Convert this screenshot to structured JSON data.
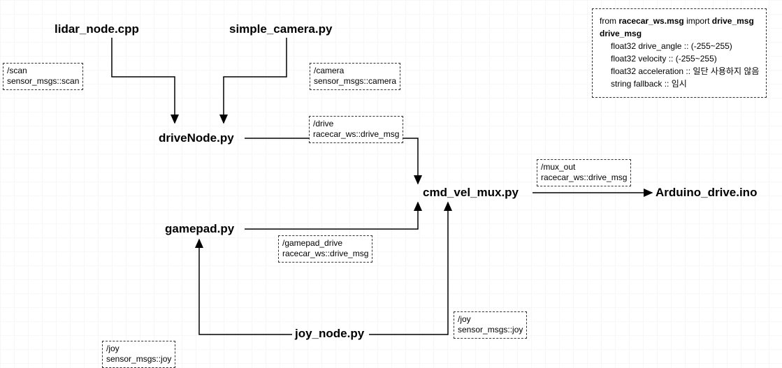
{
  "nodes": {
    "lidar": "lidar_node.cpp",
    "camera": "simple_camera.py",
    "drive": "driveNode.py",
    "gamepad": "gamepad.py",
    "mux": "cmd_vel_mux.py",
    "arduino": "Arduino_drive.ino",
    "joy": "joy_node.py"
  },
  "topics": {
    "scan": {
      "topic": "/scan",
      "type": "sensor_msgs::scan"
    },
    "camera": {
      "topic": "/camera",
      "type": "sensor_msgs::camera"
    },
    "drive": {
      "topic": "/drive",
      "type": "racecar_ws::drive_msg"
    },
    "gamepad_drive": {
      "topic": "/gamepad_drive",
      "type": "racecar_ws::drive_msg"
    },
    "mux_out": {
      "topic": "/mux_out",
      "type": "racecar_ws::drive_msg"
    },
    "joy_left": {
      "topic": "/joy",
      "type": "sensor_msgs::joy"
    },
    "joy_right": {
      "topic": "/joy",
      "type": "sensor_msgs::joy"
    }
  },
  "info": {
    "from_pre": "from ",
    "from_pkg": "racecar_ws.msg",
    "from_mid": " import ",
    "from_msg": "drive_msg",
    "type_name": "drive_msg",
    "f1": "float32 drive_angle  :: (-255~255)",
    "f2": "float32 velocity :: (-255~255)",
    "f3": "float32 acceleration :: 일단 사용하지 않음",
    "f4": "string fallback :: 임시"
  }
}
